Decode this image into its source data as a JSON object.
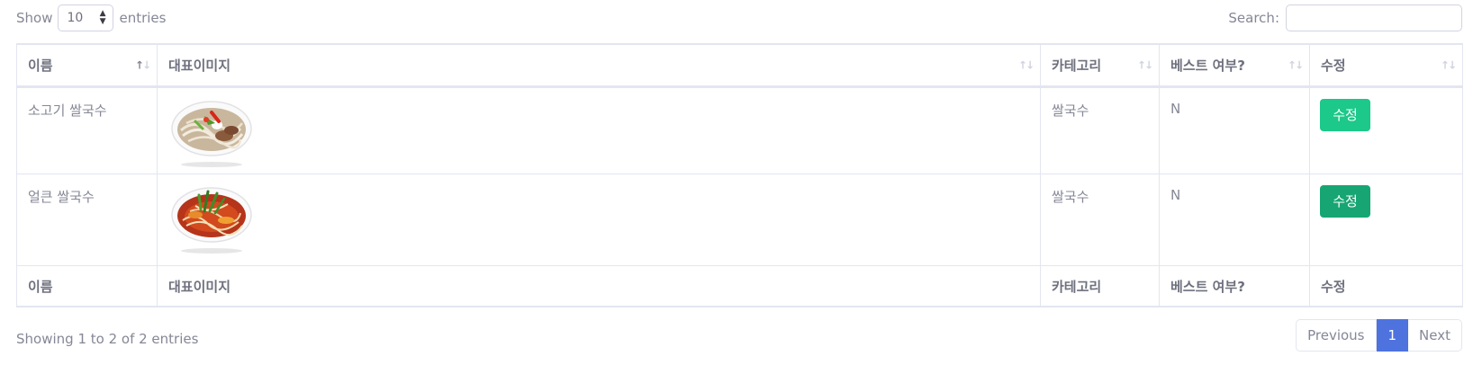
{
  "length": {
    "show_label": "Show",
    "value": "10",
    "entries_label": "entries"
  },
  "search": {
    "label": "Search:",
    "value": ""
  },
  "table": {
    "headers": [
      "이름",
      "대표이미지",
      "카테고리",
      "베스트 여부?",
      "수정"
    ],
    "footers": [
      "이름",
      "대표이미지",
      "카테고리",
      "베스트 여부?",
      "수정"
    ],
    "rows": [
      {
        "name": "소고기 쌀국수",
        "image_icon": "beef-pho-bowl-image",
        "category": "쌀국수",
        "best": "N",
        "edit_label": "수정"
      },
      {
        "name": "얼큰 쌀국수",
        "image_icon": "spicy-pho-bowl-image",
        "category": "쌀국수",
        "best": "N",
        "edit_label": "수정"
      }
    ]
  },
  "info": "Showing 1 to 2 of 2 entries",
  "pagination": {
    "previous": "Previous",
    "current": "1",
    "next": "Next"
  },
  "colors": {
    "edit_button": "#1cc88a",
    "edit_button_active": "#17a673",
    "page_active": "#4e73df"
  }
}
